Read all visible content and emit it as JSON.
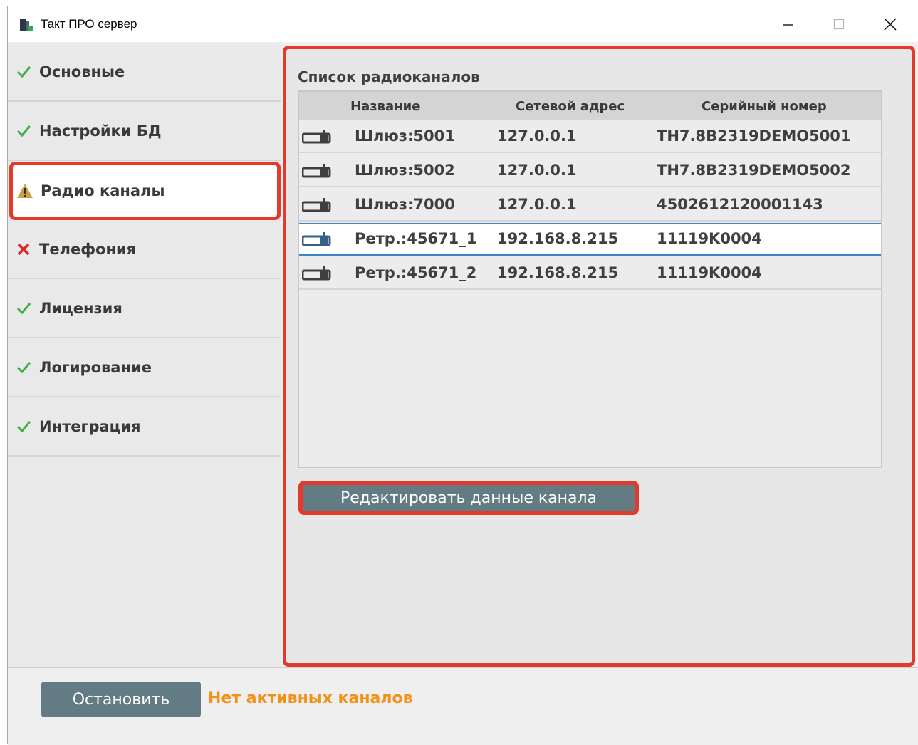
{
  "window": {
    "title": "Такт ПРО сервер"
  },
  "sidebar": {
    "items": [
      {
        "label": "Основные",
        "status": "ok"
      },
      {
        "label": "Настройки БД",
        "status": "ok"
      },
      {
        "label": "Радио каналы",
        "status": "warning",
        "active": true
      },
      {
        "label": "Телефония",
        "status": "error"
      },
      {
        "label": "Лицензия",
        "status": "ok"
      },
      {
        "label": "Логирование",
        "status": "ok"
      },
      {
        "label": "Интеграция",
        "status": "ok"
      }
    ]
  },
  "main": {
    "list_title": "Список радиоканалов",
    "columns": [
      "Название",
      "Сетевой адрес",
      "Серийный номер"
    ],
    "rows": [
      {
        "name": "Шлюз:5001",
        "address": "127.0.0.1",
        "serial": "TH7.8B2319DEMO5001",
        "icon": "radio-icon"
      },
      {
        "name": "Шлюз:5002",
        "address": "127.0.0.1",
        "serial": "TH7.8B2319DEMO5002",
        "icon": "radio-icon"
      },
      {
        "name": "Шлюз:7000",
        "address": "127.0.0.1",
        "serial": "4502612120001143",
        "icon": "radio-icon"
      },
      {
        "name": "Ретр.:45671_1",
        "address": "192.168.8.215",
        "serial": "11119K0004",
        "icon": "radio-icon",
        "selected": true
      },
      {
        "name": "Ретр.:45671_2",
        "address": "192.168.8.215",
        "serial": "11119K0004",
        "icon": "radio-icon"
      }
    ],
    "edit_button_label": "Редактировать данные канала"
  },
  "footer": {
    "stop_button_label": "Остановить",
    "status_text": "Нет активных каналов"
  },
  "colors": {
    "ok": "#3fae49",
    "warning": "#c9a04a",
    "error": "#e0262b",
    "highlight": "#e23a2c",
    "button": "#637b83",
    "status": "#f39117",
    "selected_border": "#3f86c9"
  }
}
